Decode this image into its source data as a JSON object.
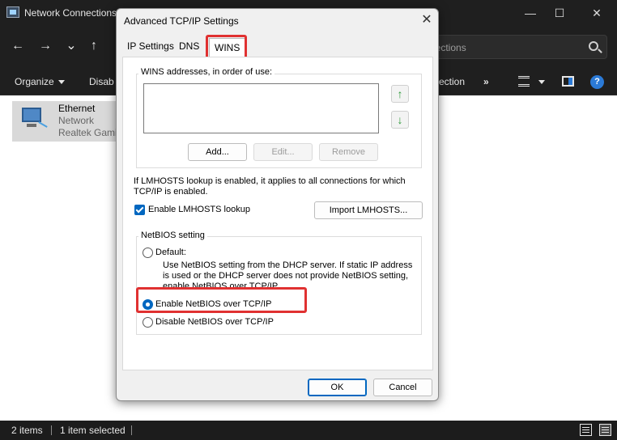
{
  "explorer": {
    "title": "Network Connections",
    "search_placeholder": "nections",
    "controls": {
      "minimize": "—",
      "maximize": "☐",
      "close": "✕"
    },
    "nav": {
      "back": "←",
      "forward": "→",
      "recent": "⌄",
      "up": "↑"
    },
    "command_bar": {
      "organize": "Organize",
      "disable": "Disab",
      "connection": "ection",
      "more": "»"
    },
    "item": {
      "name": "Ethernet",
      "status": "Network",
      "device": "Realtek Gami"
    },
    "status_bar": {
      "items_count": "2 items",
      "selected": "1 item selected"
    }
  },
  "dialog": {
    "title": "Advanced TCP/IP Settings",
    "close": "✕",
    "tabs": [
      "IP Settings",
      "DNS",
      "WINS"
    ],
    "active_tab": "WINS",
    "wins": {
      "group_label": "WINS addresses, in order of use:",
      "move_up": "↑",
      "move_down": "↓",
      "add_label": "Add...",
      "edit_label": "Edit...",
      "remove_label": "Remove",
      "lmhosts_note_line1": "If LMHOSTS lookup is enabled, it applies to all connections for which",
      "lmhosts_note_line2": "TCP/IP is enabled.",
      "enable_lmhosts_label": "Enable LMHOSTS lookup",
      "enable_lmhosts_checked": true,
      "import_lmhosts_label": "Import LMHOSTS...",
      "netbios": {
        "group_label": "NetBIOS setting",
        "default_label": "Default:",
        "default_desc_line1": "Use NetBIOS setting from the DHCP server. If static IP address",
        "default_desc_line2": "is used or the DHCP server does not provide NetBIOS setting,",
        "default_desc_line3": "enable NetBIOS over TCP/IP.",
        "enable_label": "Enable NetBIOS over TCP/IP",
        "disable_label": "Disable NetBIOS over TCP/IP",
        "selected": "enable"
      }
    },
    "ok_label": "OK",
    "cancel_label": "Cancel"
  },
  "colors": {
    "highlight": "#e03131",
    "accent": "#0067c0"
  }
}
